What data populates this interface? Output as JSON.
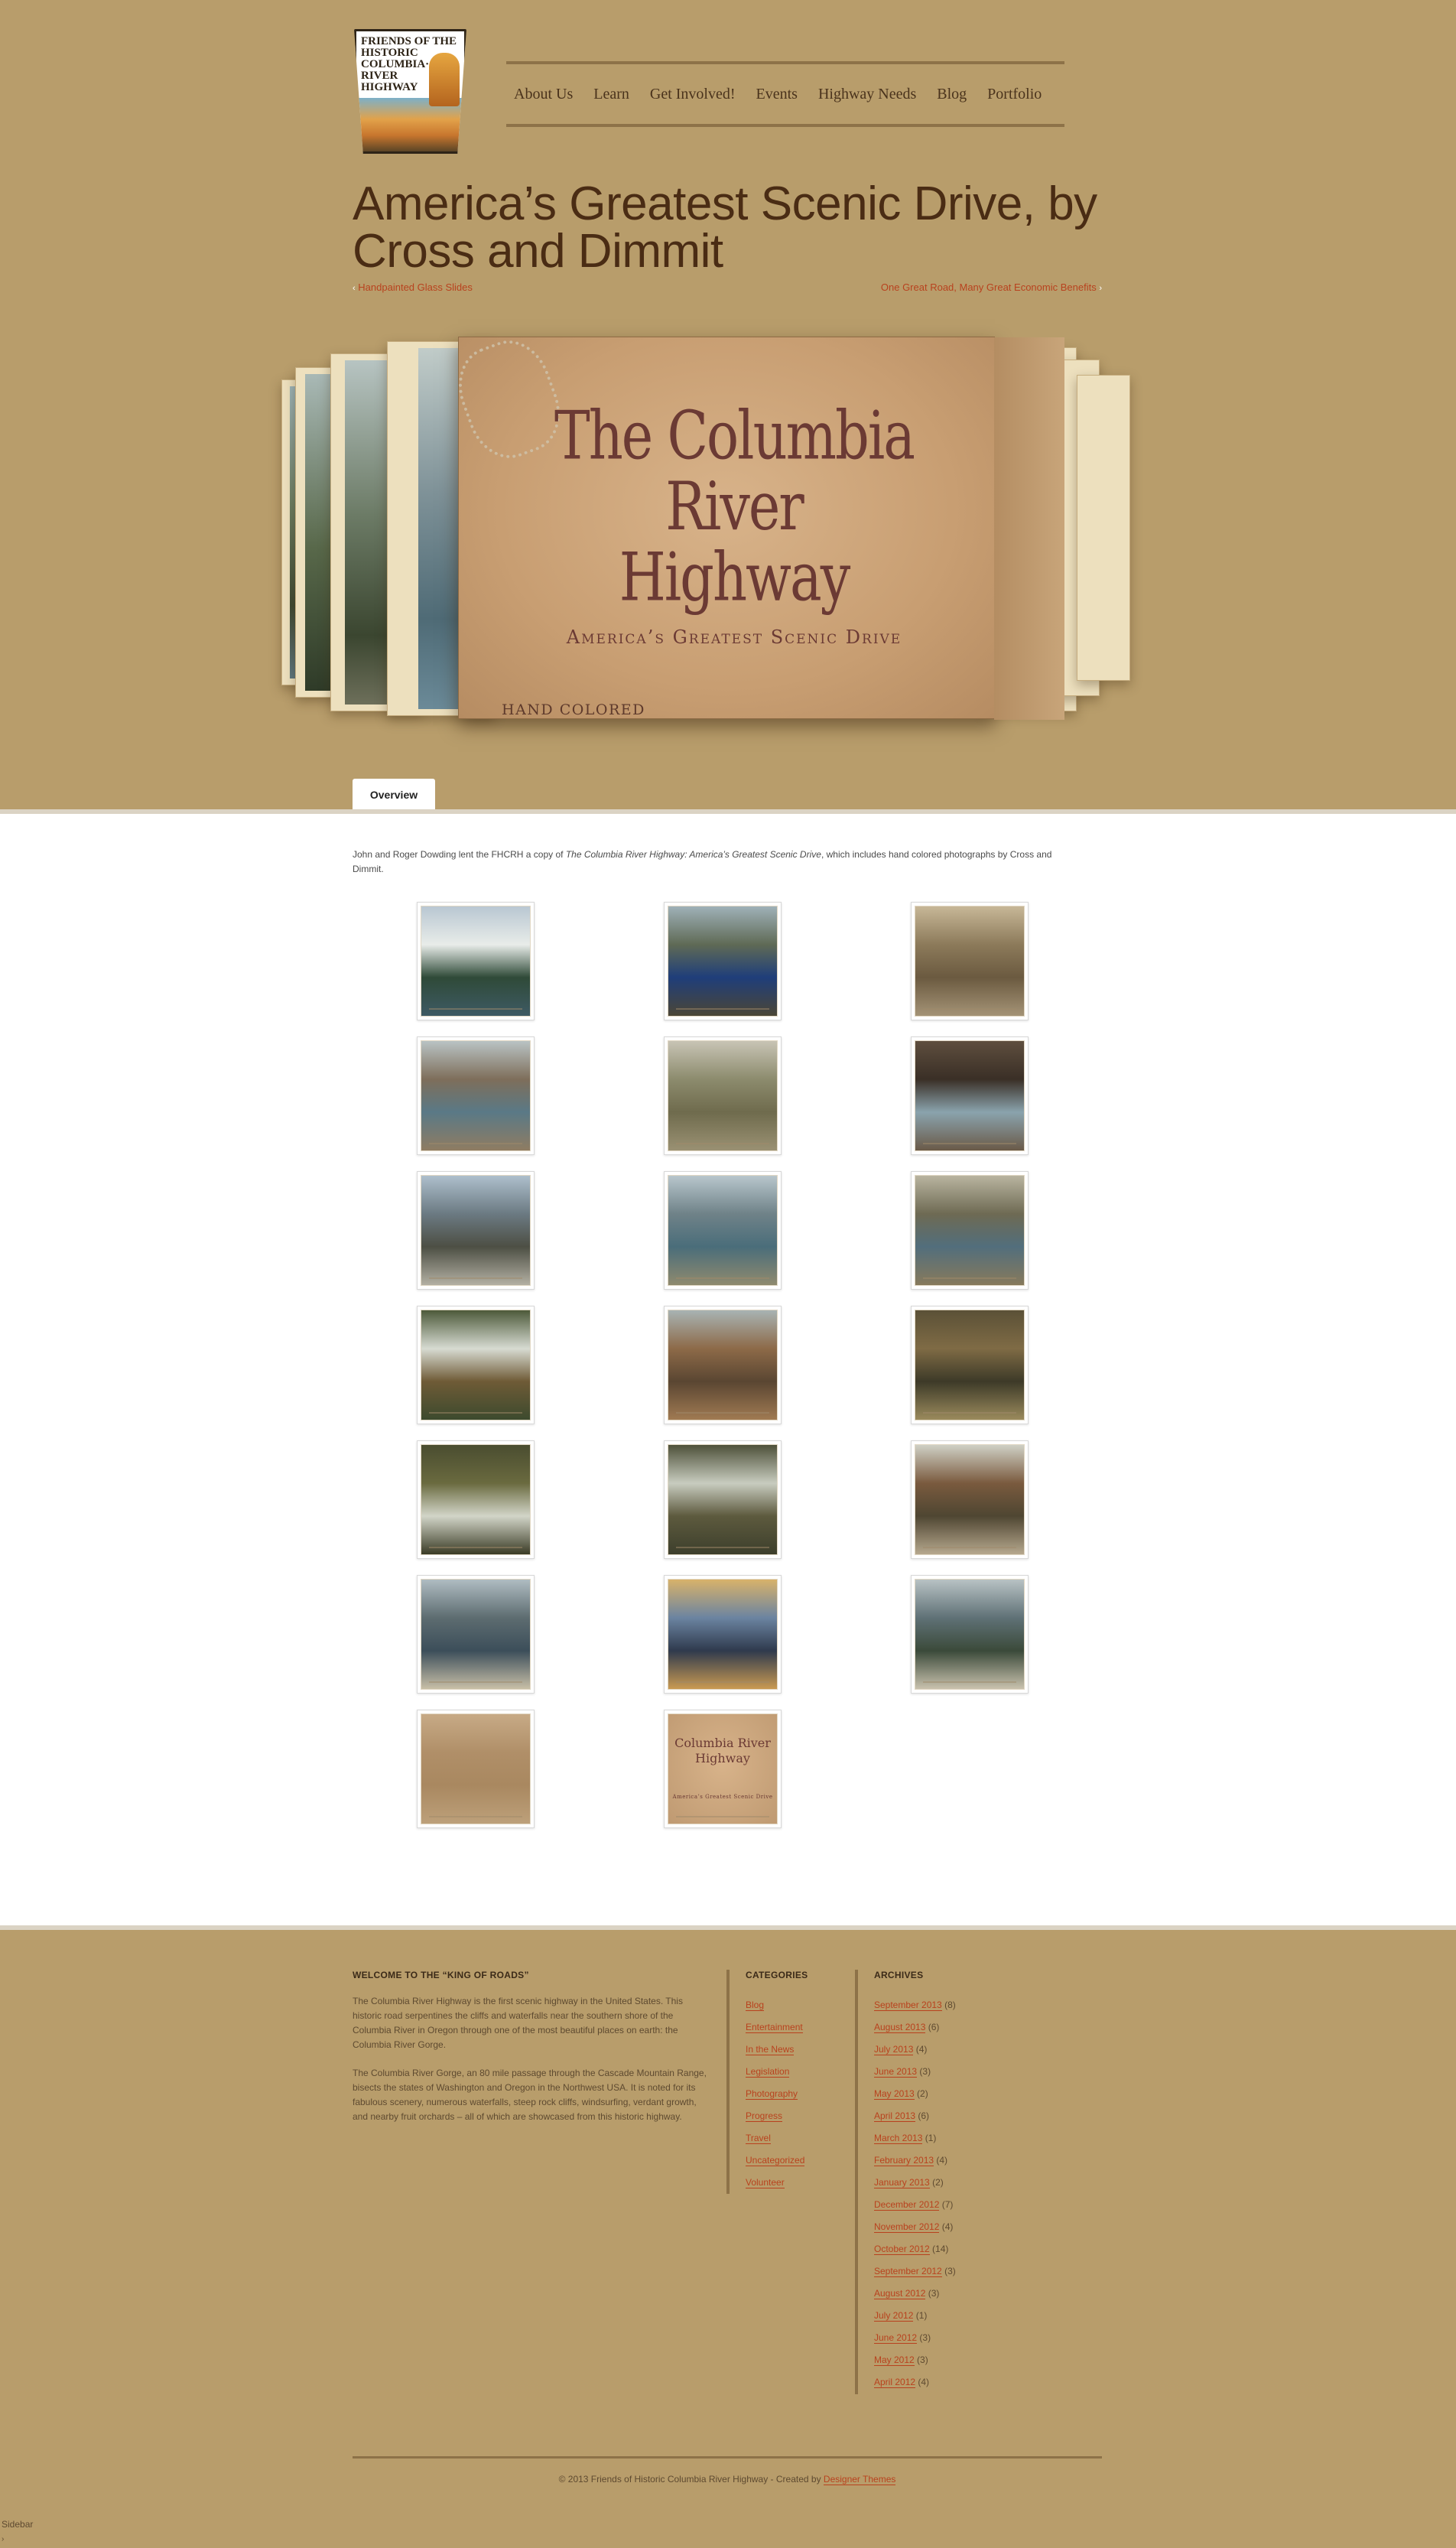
{
  "logo": {
    "lines": [
      "FRIENDS OF THE",
      "HISTORIC",
      "COLUMBIA·",
      "RIVER",
      "HIGHWAY"
    ]
  },
  "nav": [
    "About Us",
    "Learn",
    "Get Involved!",
    "Events",
    "Highway Needs",
    "Blog",
    "Portfolio"
  ],
  "post": {
    "title": "America’s Greatest Scenic Drive, by Cross and Dimmit",
    "prev": "Handpainted Glass Slides",
    "next": "One Great Road, Many Great Economic Benefits",
    "arrow_left": "‹",
    "arrow_right": "›"
  },
  "feature": {
    "title_line1": "The Columbia River",
    "title_line2": "Highway",
    "subtitle": "America’s Greatest Scenic Drive",
    "stamp": "HAND COLORED"
  },
  "tabs": [
    "Overview"
  ],
  "intro": {
    "before": "John and Roger Dowding lent the FHCRH a copy of ",
    "italic": "The Columbia River Highway: America’s Greatest Scenic Drive",
    "after": ", which includes hand colored photographs by Cross and Dimmit."
  },
  "thumbnails": [
    {
      "name": "thumb-mount-hood-lake",
      "colors": [
        "#b9c7d2",
        "#e8ece9",
        "#2f4a38",
        "#3e5a64"
      ]
    },
    {
      "name": "thumb-crater-lake",
      "colors": [
        "#9fb1b8",
        "#5f6a55",
        "#1f3e7a",
        "#4b4636"
      ]
    },
    {
      "name": "thumb-highway-loops",
      "colors": [
        "#c7b797",
        "#8c7a5a",
        "#6b5a40",
        "#a49376"
      ]
    },
    {
      "name": "thumb-rock-bluff",
      "colors": [
        "#b9c3c4",
        "#7e6e5a",
        "#5a7986",
        "#8f7c62"
      ]
    },
    {
      "name": "thumb-valley-farms",
      "colors": [
        "#c8c4b5",
        "#8c8b6d",
        "#6f6b4d",
        "#9a9173"
      ]
    },
    {
      "name": "thumb-tunnel",
      "colors": [
        "#5e4e3e",
        "#3a2f26",
        "#8aa3ad",
        "#6a5a48"
      ]
    },
    {
      "name": "thumb-gorge-road",
      "colors": [
        "#aebfcc",
        "#6b7a82",
        "#4d4f44",
        "#b3b0a3"
      ]
    },
    {
      "name": "thumb-river-boats",
      "colors": [
        "#b8c6cc",
        "#6f8288",
        "#4a6d7a",
        "#8f8a6e"
      ]
    },
    {
      "name": "thumb-fish-wheel",
      "colors": [
        "#b9b4a0",
        "#6e6a53",
        "#526e7c",
        "#877a5c"
      ]
    },
    {
      "name": "thumb-waterfall-1",
      "colors": [
        "#4d5a3a",
        "#d7dbd2",
        "#6f5b36",
        "#3d4a2e"
      ]
    },
    {
      "name": "thumb-canyon-road",
      "colors": [
        "#a8b3b3",
        "#8d6a48",
        "#5a4632",
        "#a07a52"
      ]
    },
    {
      "name": "thumb-oneonta-gorge",
      "colors": [
        "#5b5137",
        "#7f6b45",
        "#3d3a28",
        "#9a8a5c"
      ]
    },
    {
      "name": "thumb-waterfall-2",
      "colors": [
        "#4a4d30",
        "#6a6a3f",
        "#d2d5c8",
        "#3a3b25"
      ]
    },
    {
      "name": "thumb-waterfall-3",
      "colors": [
        "#4e513a",
        "#c8ccbf",
        "#5d5a3e",
        "#3d3f2c"
      ]
    },
    {
      "name": "thumb-cliff-highway",
      "colors": [
        "#cfd0c5",
        "#7a5a3e",
        "#4f4632",
        "#b6a88e"
      ]
    },
    {
      "name": "thumb-viaduct-view",
      "colors": [
        "#afbcc2",
        "#5d6c70",
        "#3c4e5a",
        "#c8bfa7"
      ]
    },
    {
      "name": "thumb-sunset-river",
      "colors": [
        "#d8b26a",
        "#6b84a1",
        "#2f3a4d",
        "#c99a52"
      ]
    },
    {
      "name": "thumb-vista-house",
      "colors": [
        "#b8c2c4",
        "#5f7176",
        "#3b4a3a",
        "#c9c2ae"
      ]
    },
    {
      "name": "thumb-text-page",
      "colors": [
        "#c7aa86",
        "#b08f68",
        "#a98860",
        "#bda07a"
      ]
    },
    {
      "name": "thumb-book-cover",
      "colors": [
        "#d2b28c",
        "#c8a37b",
        "#6b3a34",
        "#bf9a72"
      ]
    }
  ],
  "thumb_cover": {
    "line1": "Columbia River",
    "line2": "Highway",
    "line3": "America’s Greatest Scenic Drive"
  },
  "footer": {
    "welcome_title": "WELCOME TO THE “KING OF ROADS”",
    "welcome_p1": "The Columbia River Highway is the first scenic highway in the United States. This historic road serpentines the cliffs and waterfalls near the southern shore of the Columbia River in Oregon through one of the most beautiful places on earth: the Columbia River Gorge.",
    "welcome_p2": "The Columbia River Gorge, an 80 mile passage through the Cascade Mountain Range, bisects the states of Washington and Oregon in the Northwest USA. It is noted for its fabulous scenery, numerous waterfalls, steep rock cliffs, windsurfing, verdant growth, and nearby fruit orchards – all of which are showcased from this historic highway.",
    "categories_title": "CATEGORIES",
    "categories": [
      "Blog",
      "Entertainment",
      "In the News",
      "Legislation",
      "Photography",
      "Progress",
      "Travel",
      "Uncategorized",
      "Volunteer"
    ],
    "archives_title": "ARCHIVES",
    "archives": [
      {
        "label": "September 2013",
        "count": "(8)"
      },
      {
        "label": "August 2013",
        "count": "(6)"
      },
      {
        "label": "July 2013",
        "count": "(4)"
      },
      {
        "label": "June 2013",
        "count": "(3)"
      },
      {
        "label": "May 2013",
        "count": "(2)"
      },
      {
        "label": "April 2013",
        "count": "(6)"
      },
      {
        "label": "March 2013",
        "count": "(1)"
      },
      {
        "label": "February 2013",
        "count": "(4)"
      },
      {
        "label": "January 2013",
        "count": "(2)"
      },
      {
        "label": "December 2012",
        "count": "(7)"
      },
      {
        "label": "November 2012",
        "count": "(4)"
      },
      {
        "label": "October 2012",
        "count": "(14)"
      },
      {
        "label": "September 2012",
        "count": "(3)"
      },
      {
        "label": "August 2012",
        "count": "(3)"
      },
      {
        "label": "July 2012",
        "count": "(1)"
      },
      {
        "label": "June 2012",
        "count": "(3)"
      },
      {
        "label": "May 2012",
        "count": "(3)"
      },
      {
        "label": "April 2012",
        "count": "(4)"
      }
    ],
    "copyright": "© 2013 Friends of Historic Columbia River Highway - Created by ",
    "credit_link": "Designer Themes"
  },
  "sidebar_label": "Sidebar",
  "sidebar_arrow": "›",
  "colors": {
    "background": "#b89d6b",
    "link": "#b8421e",
    "heading": "#4a2c14",
    "rule": "#8d7248"
  }
}
